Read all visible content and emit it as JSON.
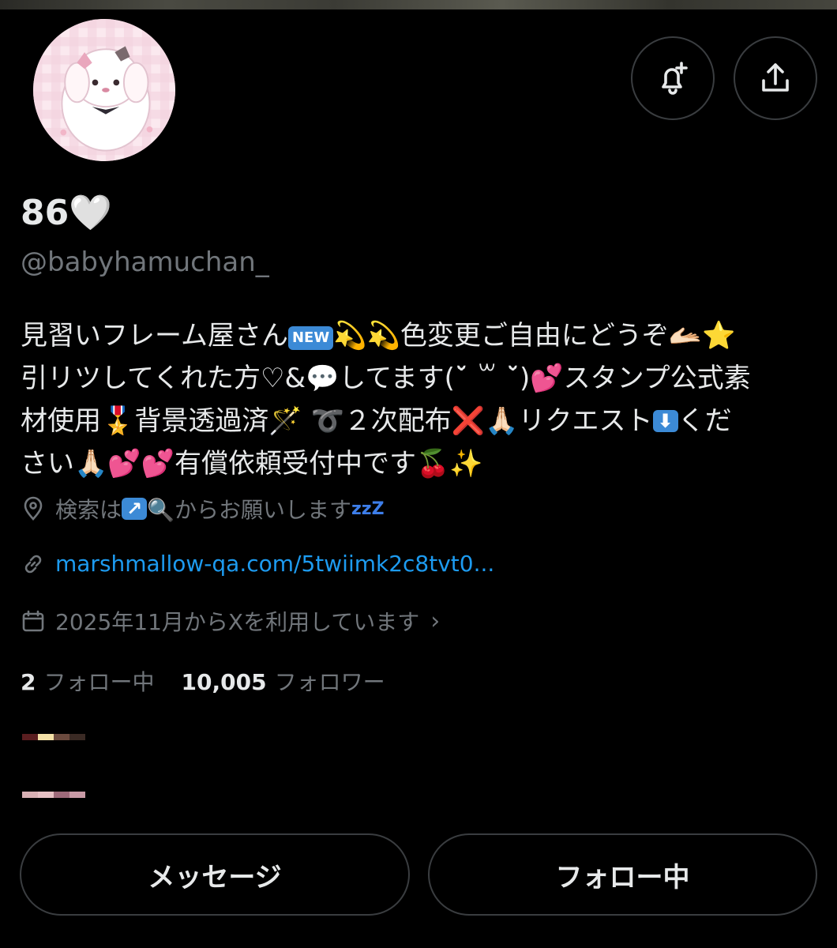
{
  "profile": {
    "display_name": "86🤍",
    "handle": "@babyhamuchan_",
    "bio": {
      "line1_a": "見習いフレーム屋さん",
      "new_badge": "NEW",
      "line1_b": "💫💫色変更ご自由にどうぞ🫴🏻⭐",
      "line2_a": "引リツしてくれた方♡&",
      "line2_b": "💬してます(ˇ̆ ꒳ ˇ̆)💕スタンプ公式素",
      "line3_a": "材使用🎖️背景透過済🪄 ➰２次配布",
      "x_mark": "❌",
      "line3_b": "🙏🏻リクエスト",
      "down_arrow": "⬇",
      "line3_c": "くだ",
      "line4": "さい🙏🏻💕💕有償依頼受付中です🍒✨"
    },
    "location": {
      "text_a": "検索は",
      "arrow": "↗",
      "text_b": "🔍からお願いします",
      "zzz": "zzZ"
    },
    "link": "marshmallow-qa.com/5twiimk2c8tvt0...",
    "joined": "2025年11月からXを利用しています",
    "joined_chevron": "›",
    "following_count": "2",
    "following_label": "フォロー中",
    "followers_count": "10,005",
    "followers_label": "フォロワー"
  },
  "buttons": {
    "message": "メッセージ",
    "following": "フォロー中"
  },
  "icons": {
    "bell": "bell-plus-icon",
    "share": "share-icon",
    "location": "location-pin-icon",
    "link": "link-icon",
    "calendar": "calendar-icon"
  },
  "colors": {
    "background": "#000000",
    "text_primary": "#e7e9ea",
    "text_secondary": "#71767b",
    "link": "#1d9bf0",
    "border": "#3a3d40"
  }
}
